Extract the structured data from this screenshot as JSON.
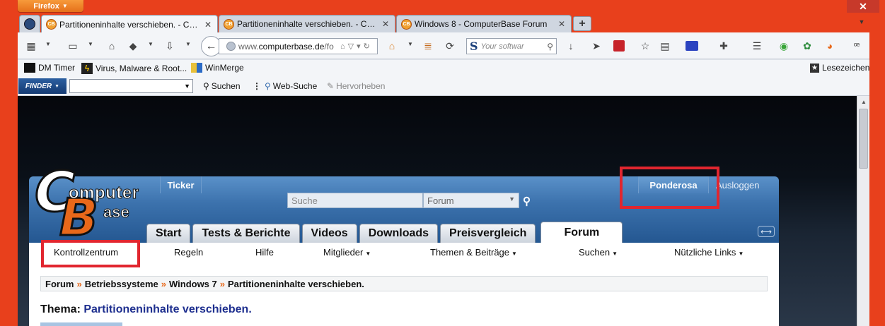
{
  "window": {
    "app_button_label": "Firefox",
    "close_label": "✕"
  },
  "tabs": [
    {
      "label": "Partitioneninhalte verschieben. - Co...",
      "active": true
    },
    {
      "label": "Partitioneninhalte verschieben. - Co...",
      "active": false
    },
    {
      "label": "Windows 8 - ComputerBase Forum",
      "active": false
    }
  ],
  "navbar": {
    "url_prefix": "www.",
    "url_host": "computerbase.de",
    "url_rest": "/fo",
    "search_engine_logo": "S",
    "search_placeholder": "Your softwar"
  },
  "bookmarks": {
    "items": [
      {
        "label": "DM Timer"
      },
      {
        "label": "Virus, Malware & Root..."
      },
      {
        "label": "WinMerge"
      }
    ],
    "right_label": "Lesezeichen"
  },
  "finder_toolbar": {
    "logo_text": "FINDER",
    "search_label": "Suchen",
    "web_search_label": "Web-Suche",
    "highlight_label": "Hervorheben"
  },
  "site": {
    "logo_line1": "omputer",
    "logo_line2": "ase",
    "logo_c": "C",
    "logo_b": "B",
    "ticker_label": "Ticker",
    "search_placeholder": "Suche",
    "search_scope": "Forum",
    "user_name": "Ponderosa",
    "logout_label": "Ausloggen",
    "main_nav": [
      "Start",
      "Tests & Berichte",
      "Videos",
      "Downloads",
      "Preisvergleich",
      "Forum"
    ],
    "active_nav": "Forum",
    "sub_nav": [
      {
        "label": "Kontrollzentrum",
        "dropdown": false
      },
      {
        "label": "Regeln",
        "dropdown": false
      },
      {
        "label": "Hilfe",
        "dropdown": false
      },
      {
        "label": "Mitglieder",
        "dropdown": true
      },
      {
        "label": "Themen & Beiträge",
        "dropdown": true
      },
      {
        "label": "Suchen",
        "dropdown": true
      },
      {
        "label": "Nützliche Links",
        "dropdown": true
      }
    ],
    "breadcrumb": [
      "Forum",
      "Betriebssysteme",
      "Windows 7",
      "Partitioneninhalte verschieben."
    ],
    "breadcrumb_separator": "»",
    "thread_prefix": "Thema:",
    "thread_title": "Partitioneninhalte verschieben."
  },
  "colors": {
    "accent_orange": "#e8681a",
    "highlight_red": "#e1262f",
    "header_blue": "#3c72ad",
    "thread_title_blue": "#1e2f8f",
    "desktop_orange": "#e8401c"
  }
}
